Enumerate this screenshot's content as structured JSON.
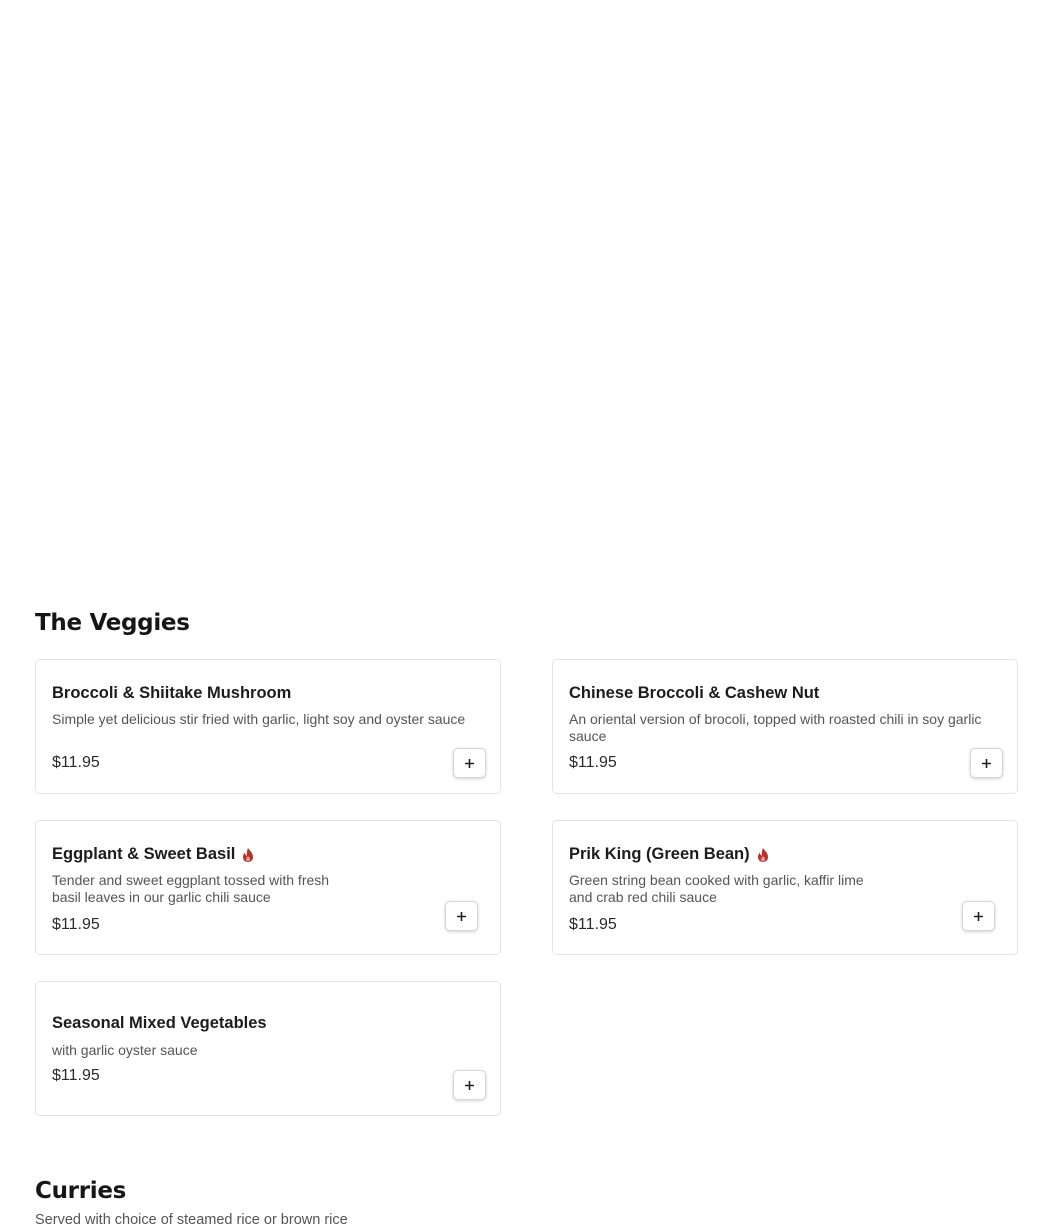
{
  "colors": {
    "spicy": "#b8322c",
    "card_border": "#e3e3e3",
    "text_primary": "#1c1c1c",
    "text_secondary": "#555555"
  },
  "sections": {
    "veggies": {
      "title": "The Veggies",
      "items": [
        {
          "name": "Broccoli & Shiitake Mushroom",
          "description": "Simple yet delicious stir fried with garlic, light soy and oyster sauce",
          "price": "$11.95",
          "spicy": false,
          "icon": "plus-icon"
        },
        {
          "name": "Chinese Broccoli & Cashew Nut",
          "description": "An oriental version of brocoli, topped with roasted chili in soy garlic sauce",
          "price": "$11.95",
          "spicy": false,
          "icon": "plus-icon"
        },
        {
          "name": "Eggplant & Sweet Basil",
          "description": "Tender and sweet eggplant tossed with fresh basil leaves in our garlic chili sauce",
          "price": "$11.95",
          "spicy": true,
          "icon": "plus-icon"
        },
        {
          "name": "Prik King (Green Bean)",
          "description": "Green string bean cooked with garlic, kaffir lime and crab red chili sauce",
          "price": "$11.95",
          "spicy": true,
          "icon": "plus-icon"
        },
        {
          "name": "Seasonal Mixed Vegetables",
          "description": "with garlic oyster sauce",
          "price": "$11.95",
          "spicy": false,
          "icon": "plus-icon"
        }
      ]
    },
    "curries": {
      "title": "Curries",
      "subtitle": "Served with choice of steamed rice or brown rice"
    }
  }
}
